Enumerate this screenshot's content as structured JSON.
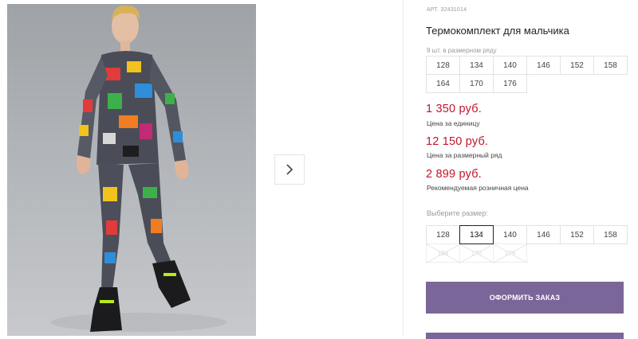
{
  "product": {
    "art": "АРТ. 32431014",
    "title": "Термокомплект для мальчика",
    "pack_count": "9 шт. в размерном ряду"
  },
  "size_row": [
    "128",
    "134",
    "140",
    "146",
    "152",
    "158",
    "164",
    "170",
    "176"
  ],
  "prices": {
    "unit_price": "1 350 руб.",
    "unit_label": "Цена за единицу",
    "row_price": "12 150 руб.",
    "row_label": "Цена за размерный ряд",
    "retail_price": "2 899 руб.",
    "retail_label": "Рекомендуемая розничная цена"
  },
  "size_picker": {
    "label": "Выберите размер:",
    "sizes": [
      "128",
      "134",
      "140",
      "146",
      "152",
      "158"
    ],
    "selected": "134",
    "disabled_sizes": [
      "164",
      "170",
      "176"
    ]
  },
  "actions": {
    "order_label": "ОФОРМИТЬ ЗАКАЗ",
    "order_color": "#7b6699"
  },
  "icons": {
    "next": "chevron-right-icon"
  },
  "colors": {
    "price": "#c4142b",
    "accent": "#7b6699"
  }
}
